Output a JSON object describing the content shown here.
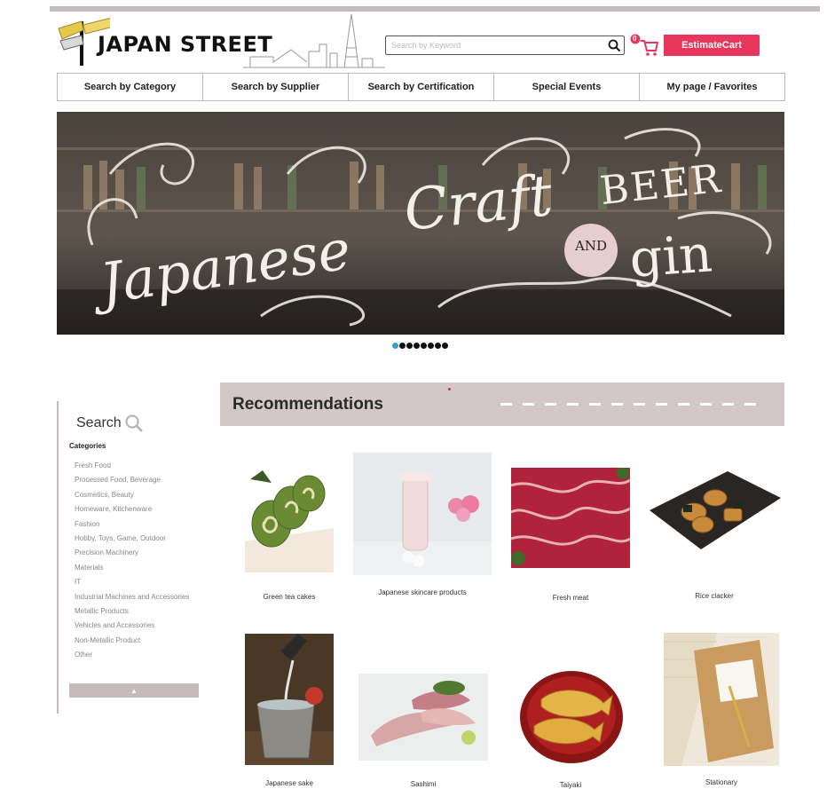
{
  "header": {
    "logo_text": "JAPAN STREET",
    "search_placeholder": "Search by Keyword",
    "cart_badge": "0",
    "cart_label": "EstimateCart"
  },
  "nav": {
    "items": [
      {
        "label": "Search by Category"
      },
      {
        "label": "Search by Supplier"
      },
      {
        "label": "Search by Certification"
      },
      {
        "label": "Special Events"
      },
      {
        "label": "My page / Favorites"
      }
    ]
  },
  "banner": {
    "line1": "Japanese",
    "line2": "Craft",
    "line3": "BEER",
    "line4": "AND",
    "line5": "gin",
    "slide_count": 8,
    "active_slide": 1
  },
  "sidebar": {
    "title": "Search",
    "categories_heading": "Categories",
    "categories": [
      {
        "label": "Fresh Food"
      },
      {
        "label": "Processed Food, Beverage"
      },
      {
        "label": "Cosmetics, Beauty"
      },
      {
        "label": "Homeware, Kitchenware"
      },
      {
        "label": "Fashion"
      },
      {
        "label": "Hobby, Toys, Game, Outdoor"
      },
      {
        "label": "Precision Machinery"
      },
      {
        "label": "Materials"
      },
      {
        "label": "IT"
      },
      {
        "label": "Industrial Machines and Accessories"
      },
      {
        "label": "Metallic Products"
      },
      {
        "label": "Vehicles and Accessories"
      },
      {
        "label": "Non-Metallic Product"
      },
      {
        "label": "Other"
      }
    ],
    "up_arrow": "▲"
  },
  "recommendations": {
    "title": "Recommendations",
    "products": [
      {
        "name": "Green tea cakes"
      },
      {
        "name": "Japanese skincare products"
      },
      {
        "name": "Fresh meat"
      },
      {
        "name": "Rice clacker"
      },
      {
        "name": "Japanese sake"
      },
      {
        "name": "Sashimi"
      },
      {
        "name": "Taiyaki"
      },
      {
        "name": "Stationary"
      }
    ]
  },
  "colors": {
    "accent": "#e8365d",
    "bar": "#d2c8c8",
    "dot_active": "#3aa0c8"
  }
}
